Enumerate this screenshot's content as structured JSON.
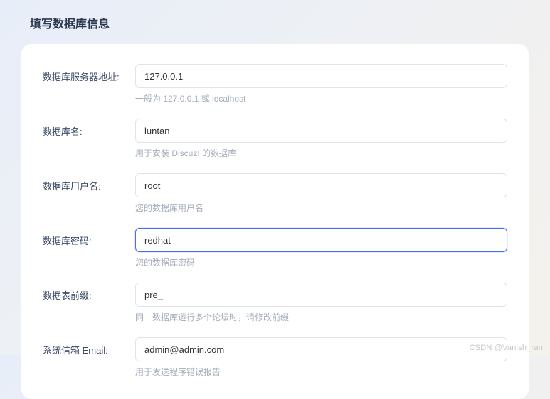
{
  "title": "填写数据库信息",
  "fields": {
    "dbhost": {
      "label": "数据库服务器地址:",
      "value": "127.0.0.1",
      "hint": "一般为 127.0.0.1 或 localhost"
    },
    "dbname": {
      "label": "数据库名:",
      "value": "luntan",
      "hint": "用于安装 Discuz! 的数据库"
    },
    "dbuser": {
      "label": "数据库用户名:",
      "value": "root",
      "hint": "您的数据库用户名"
    },
    "dbpw": {
      "label": "数据库密码:",
      "value": "redhat",
      "hint": "您的数据库密码"
    },
    "prefix": {
      "label": "数据表前缀:",
      "value": "pre_",
      "hint": "同一数据库运行多个论坛时，请修改前缀"
    },
    "email": {
      "label": "系统信箱 Email:",
      "value": "admin@admin.com",
      "hint": "用于发送程序错误报告"
    }
  },
  "watermark": "CSDN @Vanish_ran"
}
